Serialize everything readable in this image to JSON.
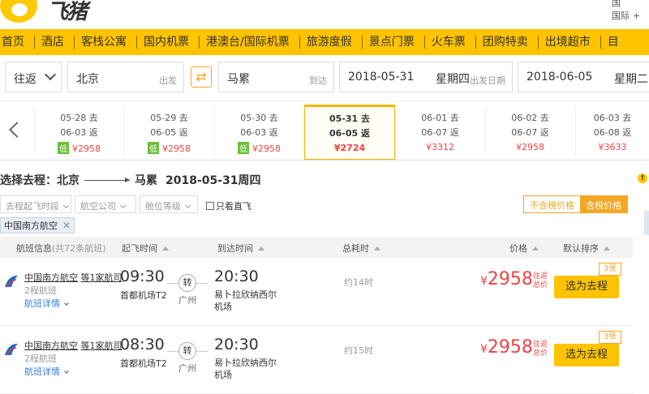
{
  "header": {
    "logo_text": "飞猪",
    "links_line1": "国",
    "links_line2a": "国际",
    "links_line2b": "+"
  },
  "nav": [
    "首页",
    "酒店",
    "客栈公寓",
    "国内机票",
    "港澳台/国际机票",
    "旅游度假",
    "景点门票",
    "火车票",
    "团购特卖",
    "出境超市",
    "目"
  ],
  "search": {
    "trip_type": "往返",
    "from": "北京",
    "from_label": "出发",
    "to": "马累",
    "to_label": "到达",
    "depart_date": "2018-05-31",
    "depart_weekday": "星期四",
    "depart_label": "出发日期",
    "return_date": "2018-06-05",
    "return_weekday": "星期二",
    "swap_icon": "⇄"
  },
  "date_strip": [
    {
      "go": "05-28 去",
      "back": "06-03 返",
      "low": "低",
      "price": "¥2958"
    },
    {
      "go": "05-29 去",
      "back": "06-05 返",
      "low": "低",
      "price": "¥2958"
    },
    {
      "go": "05-30 去",
      "back": "06-03 返",
      "low": "低",
      "price": "¥2958"
    },
    {
      "go": "05-31 去",
      "back": "06-05 返",
      "low": "",
      "price": "¥2724"
    },
    {
      "go": "06-01 去",
      "back": "06-07 返",
      "low": "",
      "price": "¥3312"
    },
    {
      "go": "06-02 去",
      "back": "06-07 返",
      "low": "",
      "price": "¥2958"
    },
    {
      "go": "06-03 去",
      "back": "06-08 返",
      "low": "",
      "price": "¥3633"
    }
  ],
  "route": {
    "prefix": "选择去程：北京",
    "dest": "马累",
    "date": "2018-05-31周四"
  },
  "filters": {
    "dep_time": "去程起飞时段",
    "airline": "航空公司",
    "cabin": "舱位等级",
    "nonstop": "只看直飞",
    "tax_off": "不含税价格",
    "tax_on": "含税价格",
    "airline_tag": "中国南方航空",
    "close": "✕"
  },
  "table_header": {
    "flight_info": "航班信息",
    "flight_count": "(共72条航班)",
    "dep": "起飞时间",
    "arr": "到达时间",
    "duration": "总耗时",
    "price": "价格",
    "sort": "默认排序"
  },
  "flights": [
    {
      "airline": "中国南方航空",
      "partners": "等1家航司",
      "legs": "2程航班",
      "detail": "航班详情",
      "dep_time": "09:30",
      "dep_airport": "首都机场T2",
      "via": "转",
      "via_city": "广州",
      "arr_time": "20:30",
      "arr_airport": "易卜拉欣纳西尔机场",
      "duration": "约14时",
      "currency": "¥",
      "price": "2958",
      "price_note": "往返总价",
      "select": "选为去程",
      "tickets": "3张"
    },
    {
      "airline": "中国南方航空",
      "partners": "等1家航司",
      "legs": "2程航班",
      "detail": "航班详情",
      "dep_time": "08:30",
      "dep_airport": "首都机场T2",
      "via": "转",
      "via_city": "广州",
      "arr_time": "20:30",
      "arr_airport": "易卜拉欣纳西尔机场",
      "duration": "约15时",
      "currency": "¥",
      "price": "2958",
      "price_note": "往返总价",
      "select": "选为去程",
      "tickets": "3张"
    }
  ],
  "colors": {
    "brand_yellow": "#ffc300",
    "price_red": "#e44444",
    "low_green": "#6bbf3a",
    "link_blue": "#3a7bd5"
  }
}
